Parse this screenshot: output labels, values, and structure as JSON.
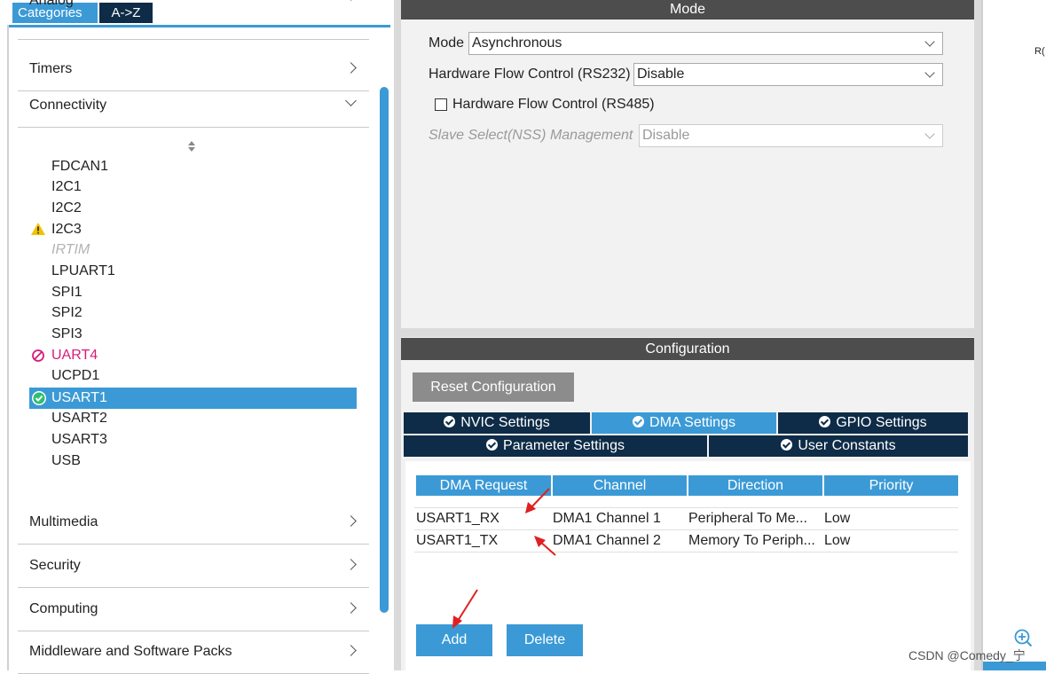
{
  "left_panel": {
    "tabs": {
      "categories": "Categories",
      "az": "A->Z"
    },
    "categories": {
      "analog": "Analog",
      "timers": "Timers",
      "connectivity": "Connectivity",
      "multimedia": "Multimedia",
      "security": "Security",
      "computing": "Computing",
      "middleware": "Middleware and Software Packs"
    },
    "peripherals": [
      {
        "name": "FDCAN1",
        "status": "normal"
      },
      {
        "name": "I2C1",
        "status": "normal"
      },
      {
        "name": "I2C2",
        "status": "normal"
      },
      {
        "name": "I2C3",
        "status": "warning"
      },
      {
        "name": "IRTIM",
        "status": "disabled"
      },
      {
        "name": "LPUART1",
        "status": "normal"
      },
      {
        "name": "SPI1",
        "status": "normal"
      },
      {
        "name": "SPI2",
        "status": "normal"
      },
      {
        "name": "SPI3",
        "status": "normal"
      },
      {
        "name": "UART4",
        "status": "error"
      },
      {
        "name": "UCPD1",
        "status": "normal"
      },
      {
        "name": "USART1",
        "status": "selected"
      },
      {
        "name": "USART2",
        "status": "normal"
      },
      {
        "name": "USART3",
        "status": "normal"
      },
      {
        "name": "USB",
        "status": "normal"
      }
    ]
  },
  "mode_panel": {
    "header": "Mode",
    "mode_label": "Mode",
    "mode_value": "Asynchronous",
    "hw_flow_rs232_label": "Hardware Flow Control (RS232)",
    "hw_flow_rs232_value": "Disable",
    "hw_flow_rs485_label": "Hardware Flow Control (RS485)",
    "hw_flow_rs485_checked": false,
    "nss_label": "Slave Select(NSS) Management",
    "nss_value": "Disable"
  },
  "config_panel": {
    "header": "Configuration",
    "reset_button": "Reset Configuration",
    "tabs": {
      "nvic": "NVIC Settings",
      "dma": "DMA Settings",
      "gpio": "GPIO Settings",
      "parameter": "Parameter Settings",
      "user_constants": "User Constants"
    },
    "active_tab": "DMA Settings",
    "dma_table": {
      "columns": [
        "DMA Request",
        "Channel",
        "Direction",
        "Priority"
      ],
      "rows": [
        [
          "USART1_RX",
          "DMA1 Channel 1",
          "Peripheral To Me...",
          "Low"
        ],
        [
          "USART1_TX",
          "DMA1 Channel 2",
          "Memory To Periph...",
          "Low"
        ]
      ]
    },
    "add_button": "Add",
    "delete_button": "Delete"
  },
  "right_side": {
    "partial_text": "R("
  },
  "watermark": "CSDN @Comedy_宁",
  "colors": {
    "accent": "#3b9ad6",
    "dark_navy": "#0e2c47",
    "header_gray": "#4d4d4d",
    "error": "#d81b7a",
    "warning": "#f2c200",
    "ok": "#2fbf71"
  }
}
